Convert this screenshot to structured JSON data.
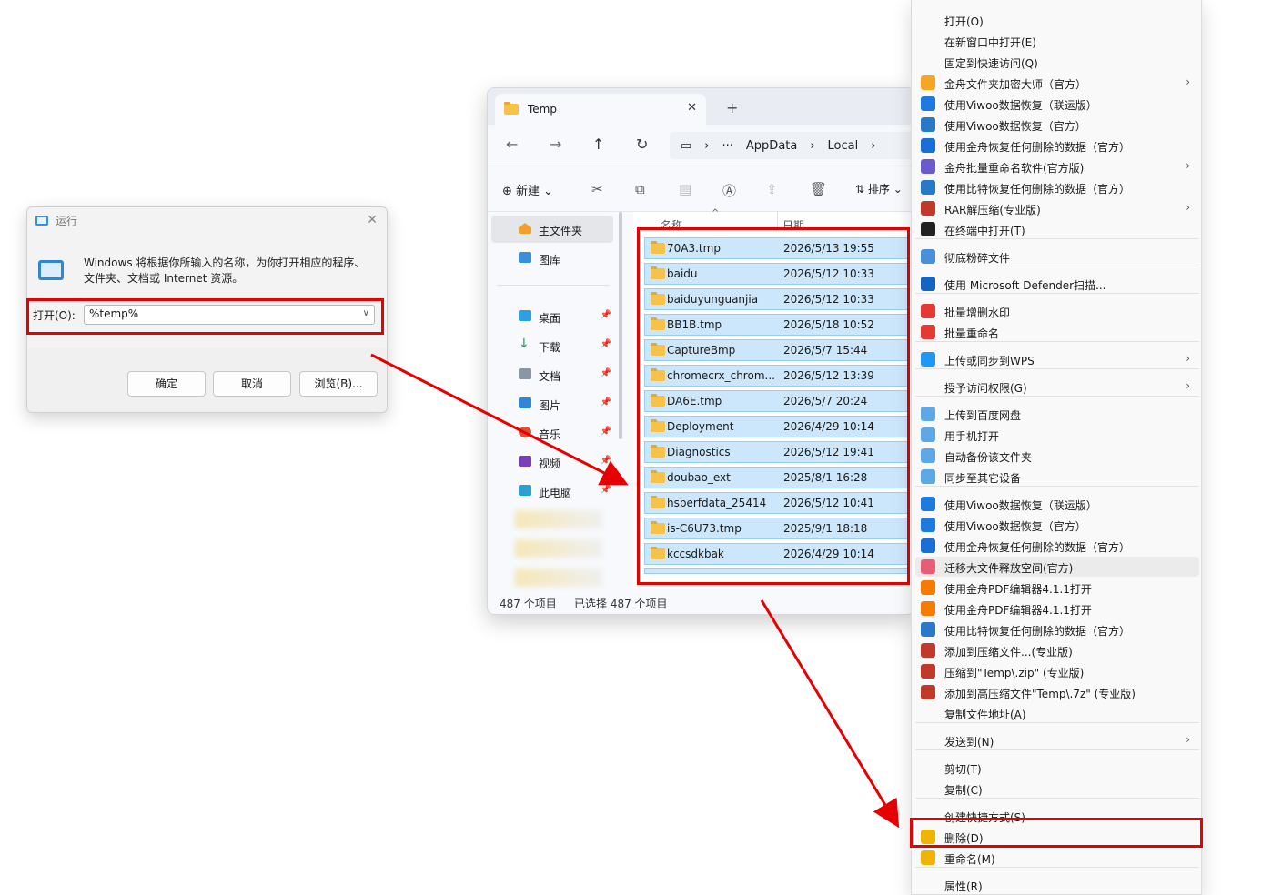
{
  "run_dialog": {
    "title": "运行",
    "description_line1": "Windows 将根据你所输入的名称，为你打开相应的程序、",
    "description_line2": "文件夹、文档或 Internet 资源。",
    "open_label": "打开(O):",
    "open_value": "%temp%",
    "ok_label": "确定",
    "cancel_label": "取消",
    "browse_label": "浏览(B)..."
  },
  "explorer": {
    "tab_title": "Temp",
    "breadcrumb": [
      "AppData",
      "Local"
    ],
    "new_label": "新建",
    "sort_label": "排序",
    "sidebar": {
      "home": "主文件夹",
      "gallery": "图库",
      "desktop": "桌面",
      "downloads": "下载",
      "documents": "文档",
      "pictures": "图片",
      "music": "音乐",
      "videos": "视频",
      "this_pc": "此电脑"
    },
    "columns": {
      "name": "名称",
      "date": "日期"
    },
    "files": [
      {
        "name": "70A3.tmp",
        "date": "2026/5/13 19:55"
      },
      {
        "name": "baidu",
        "date": "2026/5/12 10:33"
      },
      {
        "name": "baiduyunguanjia",
        "date": "2026/5/12 10:33"
      },
      {
        "name": "BB1B.tmp",
        "date": "2026/5/18 10:52"
      },
      {
        "name": "CaptureBmp",
        "date": "2026/5/7 15:44"
      },
      {
        "name": "chromecrx_chrom...",
        "date": "2026/5/12 13:39"
      },
      {
        "name": "DA6E.tmp",
        "date": "2026/5/7 20:24"
      },
      {
        "name": "Deployment",
        "date": "2026/4/29 10:14"
      },
      {
        "name": "Diagnostics",
        "date": "2026/5/12 19:41"
      },
      {
        "name": "doubao_ext",
        "date": "2025/8/1 16:28"
      },
      {
        "name": "hsperfdata_25414",
        "date": "2026/5/12 10:41"
      },
      {
        "name": "is-C6U73.tmp",
        "date": "2025/9/1 18:18"
      },
      {
        "name": "kccsdkbak",
        "date": "2026/4/29 10:14"
      }
    ],
    "status_count": "487 个项目",
    "status_selected": "已选择 487 个项目"
  },
  "context_menu": {
    "items": [
      "打开(O)",
      "在新窗口中打开(E)",
      "固定到快速访问(Q)",
      "金舟文件夹加密大师（官方）",
      "使用Viwoo数据恢复（联运版）",
      "使用Viwoo数据恢复（官方）",
      "使用金舟恢复任何删除的数据（官方）",
      "金舟批量重命名软件(官方版)",
      "使用比特恢复任何删除的数据（官方）",
      "RAR解压缩(专业版)",
      "在终端中打开(T)",
      "彻底粉碎文件",
      "使用 Microsoft Defender扫描...",
      "批量增删水印",
      "批量重命名",
      "上传或同步到WPS",
      "授予访问权限(G)",
      "上传到百度网盘",
      "用手机打开",
      "自动备份该文件夹",
      "同步至其它设备",
      "使用Viwoo数据恢复（联运版）",
      "使用Viwoo数据恢复（官方）",
      "使用金舟恢复任何删除的数据（官方）",
      "迁移大文件释放空间(官方)",
      "使用金舟PDF编辑器4.1.1打开",
      "使用金舟PDF编辑器4.1.1打开",
      "使用比特恢复任何删除的数据（官方）",
      "添加到压缩文件...(专业版)",
      "压缩到\"Temp\\.zip\" (专业版)",
      "添加到高压缩文件\"Temp\\.7z\" (专业版)",
      "复制文件地址(A)",
      "发送到(N)",
      "剪切(T)",
      "复制(C)",
      "创建快捷方式(S)",
      "删除(D)",
      "重命名(M)",
      "属性(R)"
    ]
  },
  "colors": {
    "highlight_red": "#e60000",
    "selection_blue": "#cce6fb",
    "folder_yellow": "#f6c24a"
  }
}
